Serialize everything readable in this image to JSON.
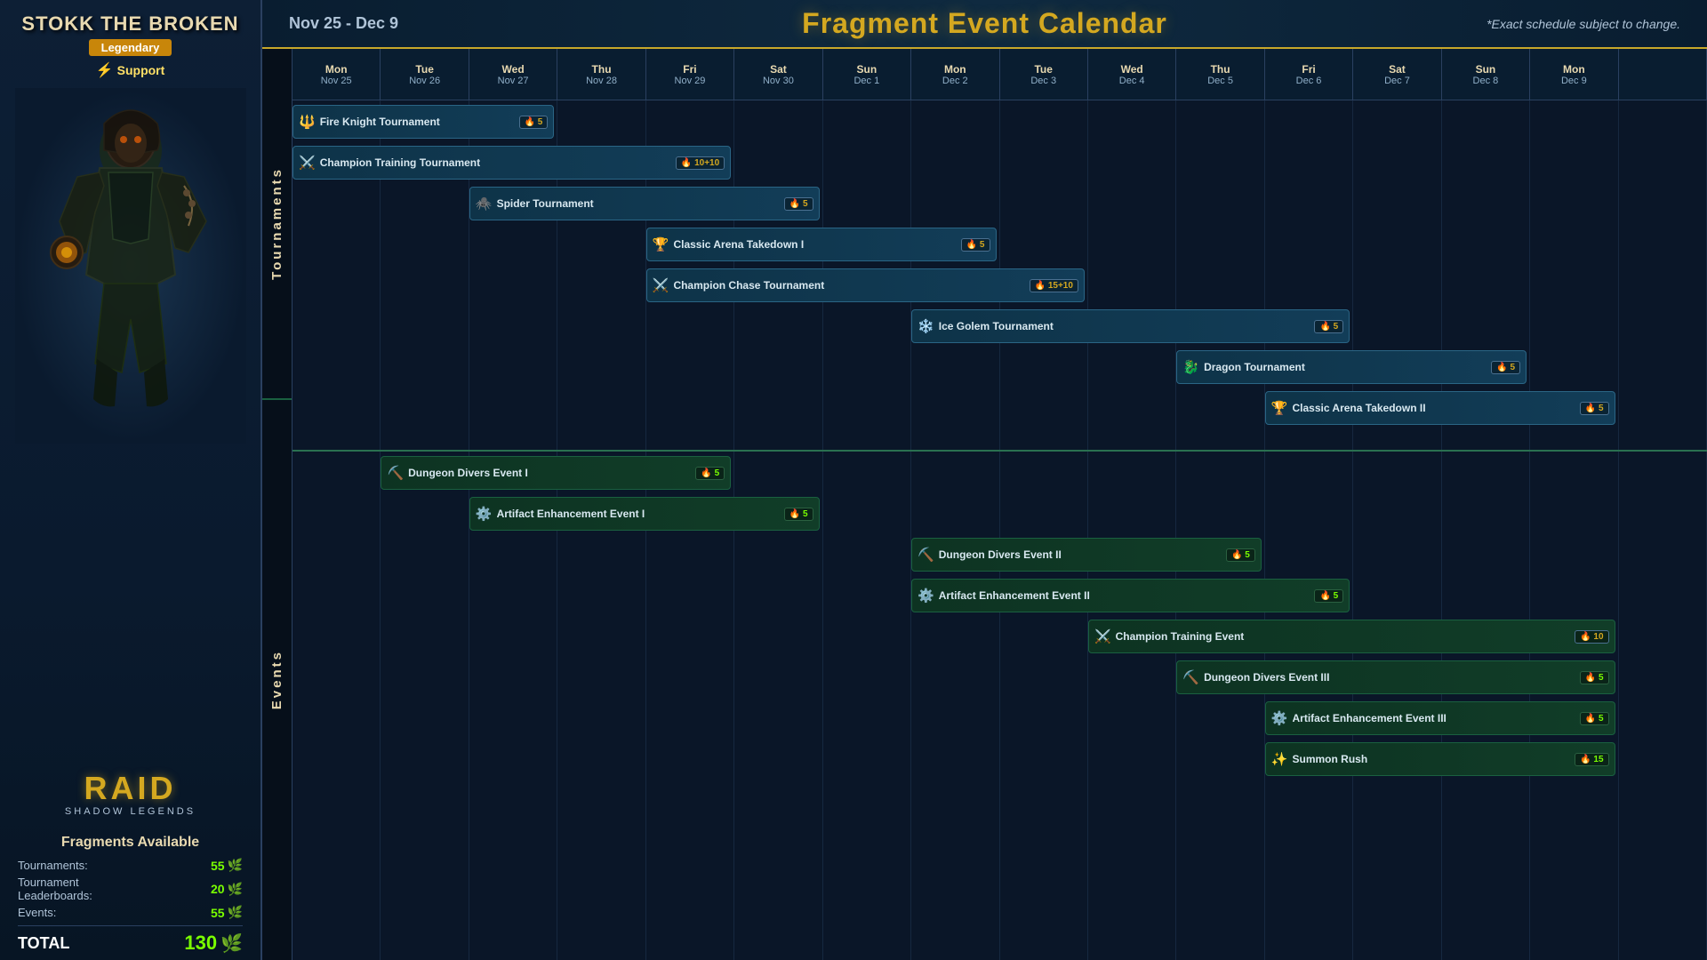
{
  "leftPanel": {
    "characterName": "STOKK THE BROKEN",
    "tier": "Legendary",
    "role": "Support",
    "gameTitle": "RAID",
    "gameSubtitle": "SHADOW LEGENDS",
    "fragmentsTitle": "Fragments Available",
    "rows": [
      {
        "label": "Tournaments:",
        "value": "55"
      },
      {
        "label": "Tournament Leaderboards:",
        "value": "20"
      },
      {
        "label": "Events:",
        "value": "55"
      }
    ],
    "totalLabel": "TOTAL",
    "totalValue": "130"
  },
  "header": {
    "dateRange": "Nov 25 - Dec 9",
    "title": "Fragment Event Calendar",
    "note": "*Exact schedule subject to change."
  },
  "columns": [
    {
      "day": "Mon",
      "date": "Nov 25"
    },
    {
      "day": "Tue",
      "date": "Nov 26"
    },
    {
      "day": "Wed",
      "date": "Nov 27"
    },
    {
      "day": "Thu",
      "date": "Nov 28"
    },
    {
      "day": "Fri",
      "date": "Nov 29"
    },
    {
      "day": "Sat",
      "date": "Nov 30"
    },
    {
      "day": "Sun",
      "date": "Dec 1"
    },
    {
      "day": "Mon",
      "date": "Dec 2"
    },
    {
      "day": "Tue",
      "date": "Dec 3"
    },
    {
      "day": "Wed",
      "date": "Dec 4"
    },
    {
      "day": "Thu",
      "date": "Dec 5"
    },
    {
      "day": "Fri",
      "date": "Dec 6"
    },
    {
      "day": "Sat",
      "date": "Dec 7"
    },
    {
      "day": "Sun",
      "date": "Dec 8"
    },
    {
      "day": "Mon",
      "date": "Dec 9"
    },
    {
      "day": "",
      "date": ""
    }
  ],
  "sectionLabels": {
    "tournaments": "Tournaments",
    "events": "Events"
  },
  "tournaments": [
    {
      "id": "fire-knight",
      "name": "Fire Knight Tournament",
      "icon": "🔱",
      "badge": "5",
      "startCol": 0,
      "spanCols": 3,
      "row": 0,
      "badgeType": "gold"
    },
    {
      "id": "champion-training-tourn",
      "name": "Champion Training Tournament",
      "icon": "⚔️",
      "badge": "10+10",
      "startCol": 0,
      "spanCols": 5,
      "row": 1,
      "badgeType": "gold"
    },
    {
      "id": "spider",
      "name": "Spider Tournament",
      "icon": "🕷️",
      "badge": "5",
      "startCol": 2,
      "spanCols": 4,
      "row": 2,
      "badgeType": "gold"
    },
    {
      "id": "classic-arena-1",
      "name": "Classic Arena Takedown I",
      "icon": "🏆",
      "badge": "5",
      "startCol": 4,
      "spanCols": 4,
      "row": 3,
      "badgeType": "gold"
    },
    {
      "id": "champion-chase",
      "name": "Champion Chase Tournament",
      "icon": "⚔️",
      "badge": "15+10",
      "startCol": 4,
      "spanCols": 5,
      "row": 4,
      "badgeType": "gold"
    },
    {
      "id": "ice-golem",
      "name": "Ice Golem Tournament",
      "icon": "❄️",
      "badge": "5",
      "startCol": 7,
      "spanCols": 5,
      "row": 5,
      "badgeType": "gold"
    },
    {
      "id": "dragon-tournament",
      "name": "Dragon Tournament",
      "icon": "🐉",
      "badge": "5",
      "startCol": 10,
      "spanCols": 4,
      "row": 6,
      "badgeType": "gold"
    },
    {
      "id": "classic-arena-2",
      "name": "Classic Arena Takedown II",
      "icon": "🏆",
      "badge": "5",
      "startCol": 11,
      "spanCols": 4,
      "row": 7,
      "badgeType": "gold"
    }
  ],
  "events": [
    {
      "id": "dungeon-divers-1",
      "name": "Dungeon Divers Event I",
      "icon": "⛏️",
      "badge": "5",
      "startCol": 1,
      "spanCols": 4,
      "row": 0,
      "badgeType": "green"
    },
    {
      "id": "artifact-enhance-1",
      "name": "Artifact Enhancement Event I",
      "icon": "⚙️",
      "badge": "5",
      "startCol": 2,
      "spanCols": 4,
      "row": 1,
      "badgeType": "green"
    },
    {
      "id": "dungeon-divers-2",
      "name": "Dungeon Divers Event II",
      "icon": "⛏️",
      "badge": "5",
      "startCol": 7,
      "spanCols": 4,
      "row": 2,
      "badgeType": "green"
    },
    {
      "id": "artifact-enhance-2",
      "name": "Artifact Enhancement Event II",
      "icon": "⚙️",
      "badge": "5",
      "startCol": 7,
      "spanCols": 5,
      "row": 3,
      "badgeType": "green"
    },
    {
      "id": "champion-training-event",
      "name": "Champion Training Event",
      "icon": "⚔️",
      "badge": "10",
      "startCol": 9,
      "spanCols": 6,
      "row": 4,
      "badgeType": "gold"
    },
    {
      "id": "dungeon-divers-3",
      "name": "Dungeon Divers  Event III",
      "icon": "⛏️",
      "badge": "5",
      "startCol": 10,
      "spanCols": 5,
      "row": 5,
      "badgeType": "green"
    },
    {
      "id": "artifact-enhance-3",
      "name": "Artifact Enhancement Event III",
      "icon": "⚙️",
      "badge": "5",
      "startCol": 11,
      "spanCols": 4,
      "row": 6,
      "badgeType": "green"
    },
    {
      "id": "summon-rush",
      "name": "Summon Rush",
      "icon": "✨",
      "badge": "15",
      "startCol": 11,
      "spanCols": 4,
      "row": 7,
      "badgeType": "green"
    }
  ]
}
